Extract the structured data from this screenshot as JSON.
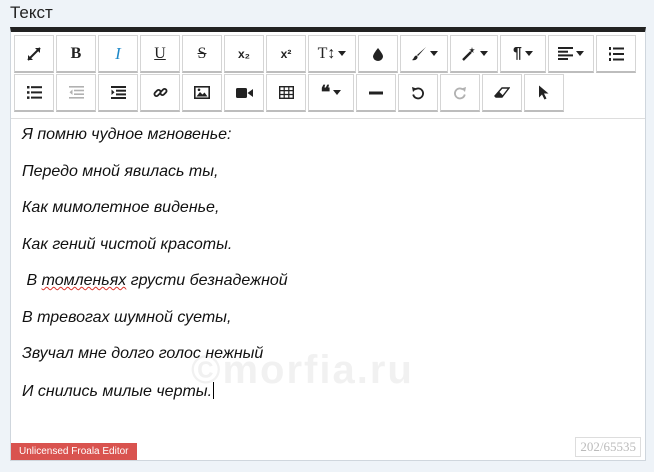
{
  "field": {
    "label": "Текст"
  },
  "toolbar": {
    "bold_label": "B",
    "italic_label": "I",
    "underline_label": "U",
    "strike_label": "S",
    "subscript_label": "x₂",
    "superscript_label": "x²",
    "fontsize_label": "T↕",
    "paragraph_label": "¶",
    "quote_label": "❝"
  },
  "content": {
    "lines": [
      "Я помню чудное мгновенье:",
      "Передо мной явилась ты,",
      "Как мимолетное виденье,",
      "Как гений чистой красоты.",
      " В ",
      "томленьях",
      " грусти безнадежной",
      "В тревогах шумной суеты,",
      "Звучал мне долго голос нежный",
      "И снились милые черты."
    ]
  },
  "watermark": "©morfia.ru",
  "footer": {
    "license_text": "Unlicensed Froala Editor",
    "char_count": "202/65535"
  },
  "colors": {
    "toolbar_top_border": "#222222",
    "license_bg": "#d9534f",
    "italic_accent": "#1e88c8"
  }
}
